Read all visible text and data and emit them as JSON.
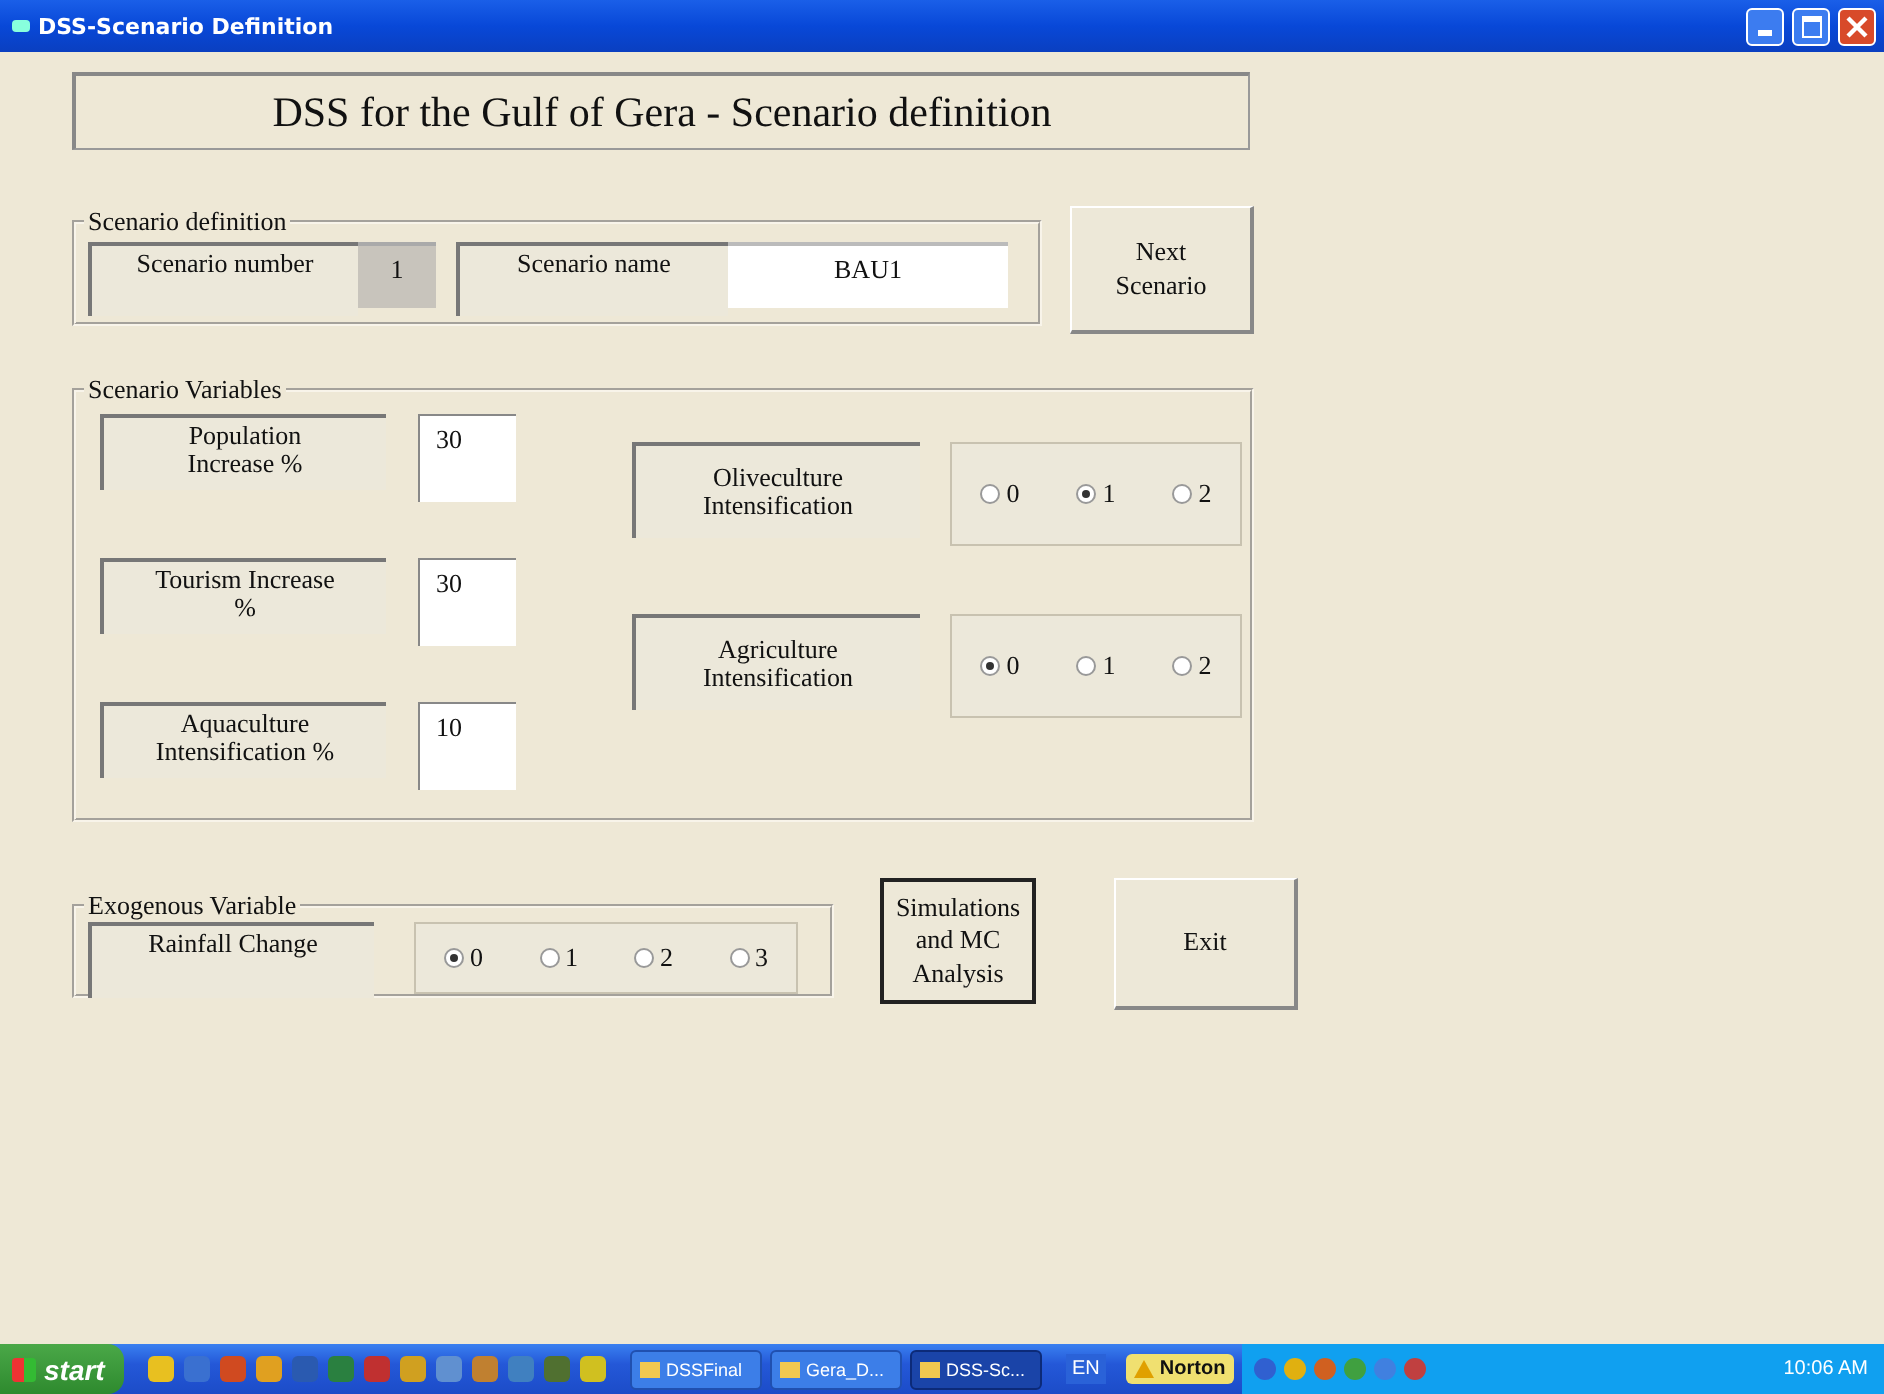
{
  "window": {
    "title": "DSS-Scenario Definition"
  },
  "header": "DSS for the Gulf of Gera - Scenario definition",
  "scenario_definition": {
    "legend": "Scenario definition",
    "number_label": "Scenario number",
    "number": "1",
    "name_label": "Scenario name",
    "name": "BAU1"
  },
  "next_button": "Next Scenario",
  "scenario_variables": {
    "legend": "Scenario Variables",
    "inputs": [
      {
        "label": "Population Increase %",
        "value": "30"
      },
      {
        "label": "Tourism Increase %",
        "value": "30"
      },
      {
        "label": "Aquaculture Intensification %",
        "value": "10"
      }
    ],
    "options": [
      {
        "label": "Oliveculture Intensification",
        "choices": [
          {
            "label": "0",
            "selected": false
          },
          {
            "label": "1",
            "selected": true
          },
          {
            "label": "2",
            "selected": false
          }
        ]
      },
      {
        "label": "Agriculture Intensification",
        "choices": [
          {
            "label": "0",
            "selected": true
          },
          {
            "label": "1",
            "selected": false
          },
          {
            "label": "2",
            "selected": false
          }
        ]
      }
    ]
  },
  "exogenous": {
    "legend": "Exogenous Variable",
    "variables": [
      {
        "label": "Rainfall Change",
        "choices": [
          {
            "label": "0",
            "selected": true
          },
          {
            "label": "1",
            "selected": false
          },
          {
            "label": "2",
            "selected": false
          },
          {
            "label": "3",
            "selected": false
          }
        ]
      }
    ]
  },
  "buttons": [
    {
      "label": "Simulations and MC Analysis",
      "focused": true
    },
    {
      "label": "Exit",
      "focused": false
    }
  ],
  "taskbar": {
    "start": "start",
    "tasks": [
      {
        "label": "DSSFinal",
        "active": false
      },
      {
        "label": "Gera_D...",
        "active": false
      },
      {
        "label": "DSS-Sc...",
        "active": true
      }
    ],
    "language": "EN",
    "norton": "Norton",
    "clock": "10:06 AM"
  }
}
